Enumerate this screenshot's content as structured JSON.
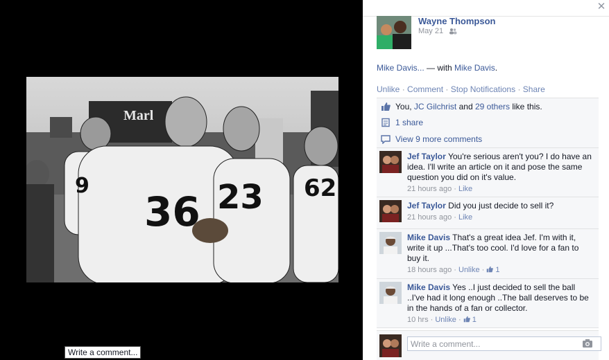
{
  "post": {
    "author_name": "Wayne Thompson",
    "date": "May 21",
    "text_link": "Mike Davis...",
    "text_with": " — with ",
    "text_tagged": "Mike Davis",
    "text_end": ".",
    "privacy_icon": "friends-icon"
  },
  "actions": {
    "unlike": "Unlike",
    "comment": "Comment",
    "stop_notifications": "Stop Notifications",
    "share": "Share",
    "separator": " · "
  },
  "summary": {
    "likes_prefix": "You, ",
    "likes_friend": "JC Gilchrist",
    "likes_and": " and ",
    "likes_others": "29 others",
    "likes_suffix": " like this.",
    "shares": "1 share",
    "view_more": "View 9 more comments"
  },
  "photo": {
    "scoreboard": "Marl",
    "jerseys": [
      "9",
      "36",
      "23",
      "62"
    ]
  },
  "comments": [
    {
      "author": "Jef Taylor",
      "text": "You're serious aren't you? I do have an idea. I'll write an article on it and pose the same question you did on it's value.",
      "time": "21 hours ago",
      "action": "Like"
    },
    {
      "author": "Jef Taylor",
      "text": "Did you just decide to sell it?",
      "time": "21 hours ago",
      "action": "Like"
    },
    {
      "author": "Mike Davis",
      "text": "That's a great idea Jef. I'm with it, write it up ...That's too cool. I'd love for a fan to buy it.",
      "time": "18 hours ago",
      "action": "Unlike",
      "likes": "1"
    },
    {
      "author": "Mike Davis",
      "text": "Yes ..I just decided to sell the ball ..I've had it long enough ..The ball deserves to be in the hands of a fan or collector.",
      "time": "10 hrs",
      "action": "Unlike",
      "likes": "1"
    }
  ],
  "composer": {
    "placeholder": "Write a comment...",
    "tooltip": "Write a comment..."
  },
  "colors": {
    "link": "#3b5998",
    "panel_bg": "#f6f7f9",
    "stage_bg": "#000000"
  }
}
